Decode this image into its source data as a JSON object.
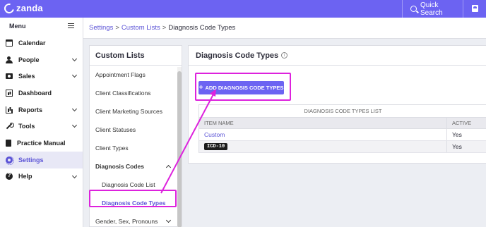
{
  "app": {
    "logo_text": "zanda"
  },
  "topbar": {
    "quick_search": "Quick Search"
  },
  "nav": {
    "header": "Menu",
    "items": [
      {
        "label": "Calendar",
        "icon": "calendar-icon"
      },
      {
        "label": "People",
        "icon": "people-icon"
      },
      {
        "label": "Sales",
        "icon": "sales-icon"
      },
      {
        "label": "Dashboard",
        "icon": "dashboard-icon"
      },
      {
        "label": "Reports",
        "icon": "reports-icon"
      },
      {
        "label": "Tools",
        "icon": "tools-icon"
      },
      {
        "label": "Practice Manual",
        "icon": "manual-icon"
      },
      {
        "label": "Settings",
        "icon": "settings-icon",
        "active": true
      },
      {
        "label": "Help",
        "icon": "help-icon"
      }
    ]
  },
  "breadcrumb": {
    "settings": "Settings",
    "sep": ">",
    "custom_lists": "Custom Lists",
    "current": "Diagnosis Code Types"
  },
  "lists": {
    "title": "Custom Lists",
    "items": [
      "Appointment Flags",
      "Client Classifications",
      "Client Marketing Sources",
      "Client Statuses",
      "Client Types",
      "Diagnosis Codes",
      "Diagnosis Code List",
      "Diagnosis Code Types",
      "Gender, Sex, Pronouns"
    ]
  },
  "main": {
    "title": "Diagnosis Code Types",
    "info_icon": "i",
    "add_button": "ADD DIAGNOSIS CODE TYPES",
    "add_plus": "+",
    "table": {
      "caption": "DIAGNOSIS CODE TYPES LIST",
      "headers": [
        "ITEM NAME",
        "ACTIVE"
      ],
      "rows": [
        {
          "name": "Custom",
          "active": "Yes"
        },
        {
          "name": "ICD-10",
          "active": "Yes"
        }
      ]
    }
  },
  "colors": {
    "brand": "#6c63f2",
    "highlight": "#dd22dd",
    "link": "#5b53d6"
  }
}
